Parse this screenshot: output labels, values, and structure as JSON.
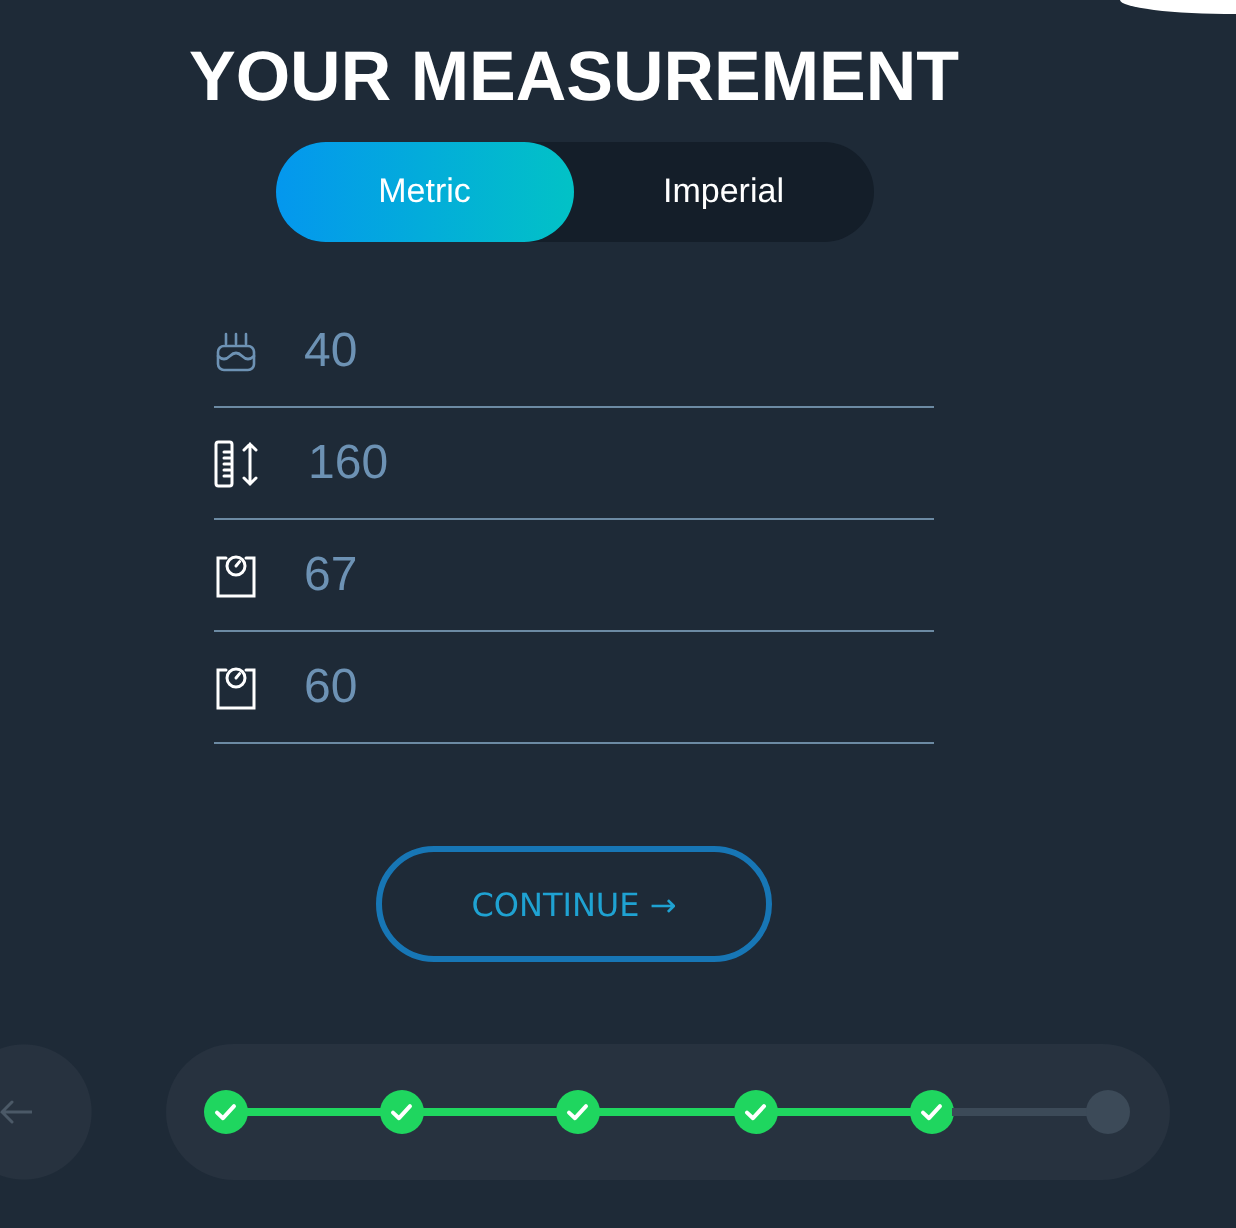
{
  "title": "YOUR MEASUREMENT",
  "unit_toggle": [
    {
      "label": "Metric",
      "selected": true
    },
    {
      "label": "Imperial",
      "selected": false
    }
  ],
  "fields": [
    {
      "kind": "age",
      "value": "40"
    },
    {
      "kind": "height",
      "value": "160"
    },
    {
      "kind": "weight",
      "value": "67"
    },
    {
      "kind": "weight",
      "value": "60"
    }
  ],
  "continue_button": {
    "label": "CONTINUE →"
  },
  "progress": {
    "steps": [
      {
        "completed": true
      },
      {
        "completed": true
      },
      {
        "completed": true
      },
      {
        "completed": true
      },
      {
        "completed": true
      },
      {
        "completed": false
      }
    ]
  }
}
